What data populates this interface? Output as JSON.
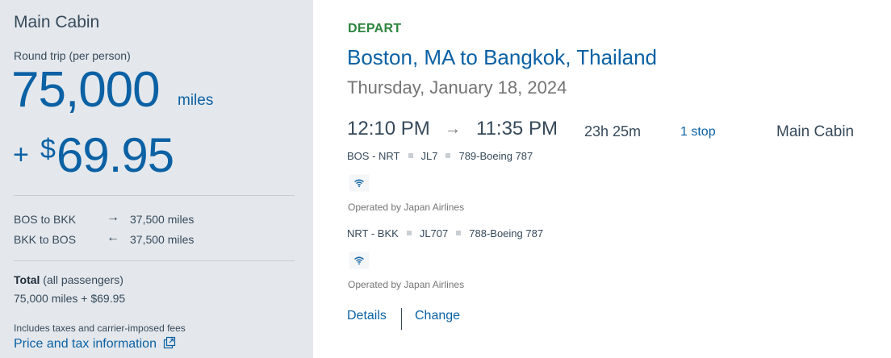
{
  "summary": {
    "cabin": "Main Cabin",
    "trip_type": "Round trip (per person)",
    "miles_amount": "75,000",
    "miles_unit": "miles",
    "plus": "+",
    "dollar_sign": "$",
    "fee_amount": "69.95",
    "segments": [
      {
        "route": "BOS to BKK",
        "arrow": "→",
        "miles": "37,500 miles"
      },
      {
        "route": "BKK to BOS",
        "arrow": "←",
        "miles": "37,500 miles"
      }
    ],
    "total_bold": "Total",
    "total_rest": " (all passengers)",
    "total_value": "75,000 miles + $69.95",
    "taxes_note": "Includes taxes and carrier-imposed fees",
    "price_link": "Price and tax information"
  },
  "flight": {
    "direction": "DEPART",
    "route": "Boston, MA to Bangkok, Thailand",
    "date": "Thursday, January 18, 2024",
    "depart_time": "12:10 PM",
    "time_arrow": "→",
    "arrive_time": "11:35 PM",
    "duration": "23h 25m",
    "stops": "1 stop",
    "cabin": "Main Cabin",
    "legs": [
      {
        "route": "BOS - NRT",
        "flight": "JL7",
        "aircraft": "789-Boeing 787",
        "wifi_icon": "wifi-icon",
        "operated": "Operated by Japan Airlines"
      },
      {
        "route": "NRT - BKK",
        "flight": "JL707",
        "aircraft": "788-Boeing 787",
        "wifi_icon": "wifi-icon",
        "operated": "Operated by Japan Airlines"
      }
    ],
    "details_link": "Details",
    "change_link": "Change"
  },
  "colors": {
    "accent_blue": "#0b61a4",
    "depart_green": "#2e8540",
    "panel_bg": "#e4e8ec",
    "text": "#36495a"
  }
}
